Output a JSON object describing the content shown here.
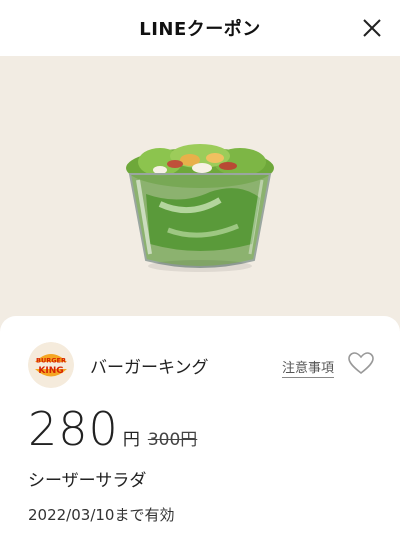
{
  "header": {
    "title": "LINEクーポン",
    "close_icon": "close-icon"
  },
  "hero": {
    "background_color": "#f2ece3",
    "image_icon": "salad-cup-image"
  },
  "coupon": {
    "brand_name": "バーガーキング",
    "logo_text_top": "BURGER",
    "logo_text_bottom": "KING",
    "notice_label": "注意事項",
    "favorite_icon": "heart-icon",
    "price": "280",
    "price_unit": "円",
    "original_price": "300円",
    "product_name": "シーザーサラダ",
    "validity": "2022/03/10まで有効"
  },
  "colors": {
    "logo_red": "#d62300",
    "logo_orange": "#f5a623",
    "logo_cream": "#f5ebdc"
  }
}
